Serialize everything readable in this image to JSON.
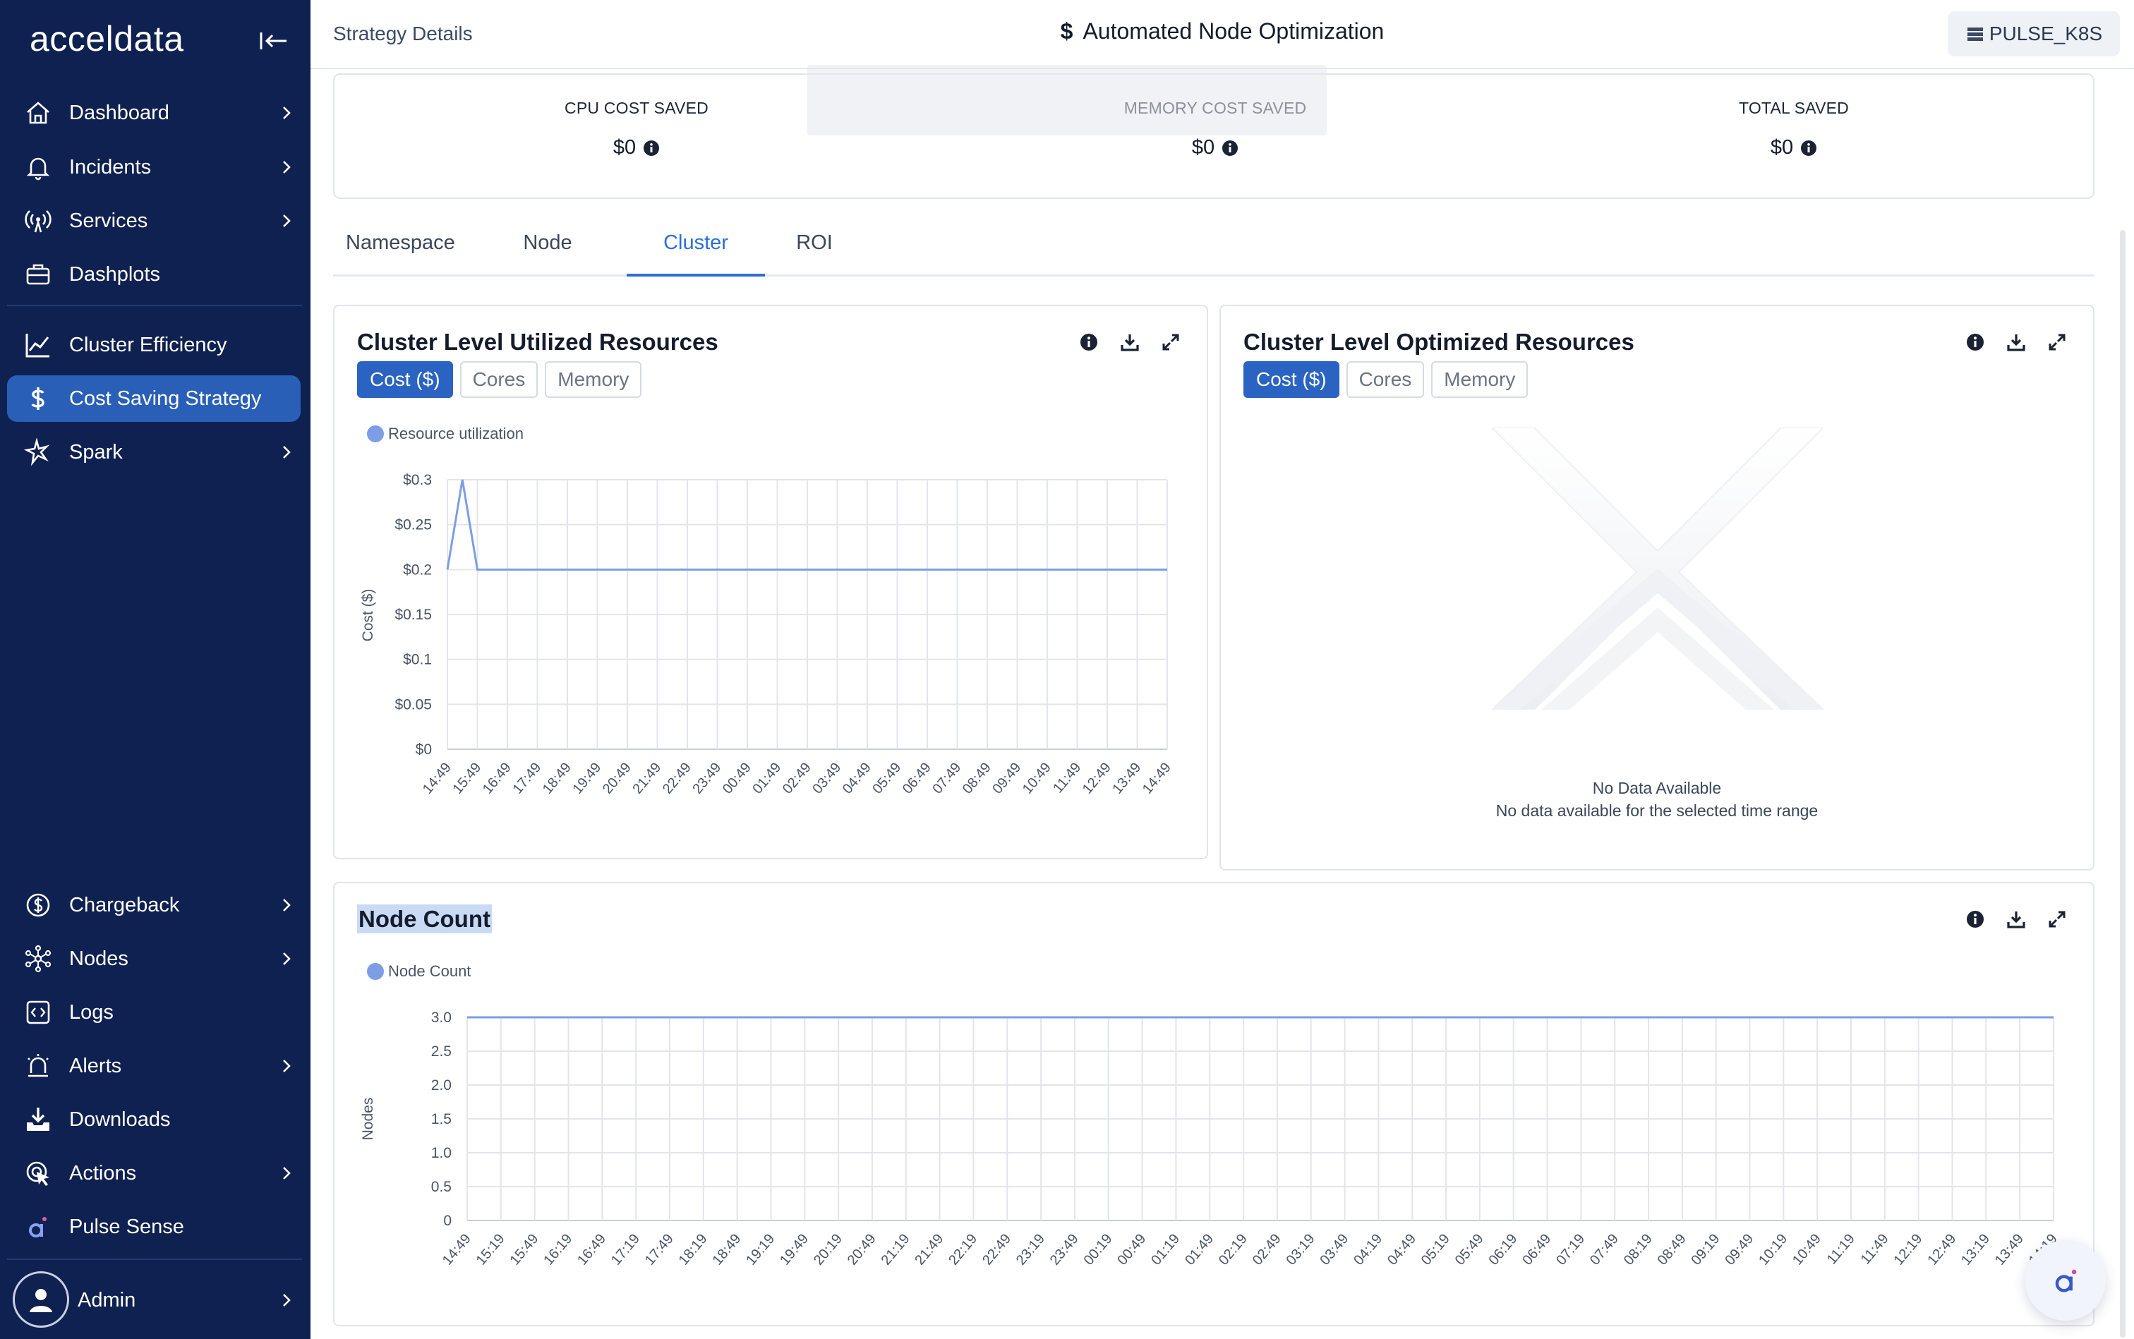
{
  "app": {
    "logo_text": "acceldata"
  },
  "sidebar": {
    "top_items": [
      {
        "label": "Dashboard",
        "icon": "home-icon",
        "chevron": true
      },
      {
        "label": "Incidents",
        "icon": "bell-icon",
        "chevron": true
      },
      {
        "label": "Services",
        "icon": "broadcast-icon",
        "chevron": true
      },
      {
        "label": "Dashplots",
        "icon": "briefcase-icon",
        "chevron": false
      }
    ],
    "mid_items": [
      {
        "label": "Cluster Efficiency",
        "icon": "trend-chart-icon",
        "chevron": false
      },
      {
        "label": "Cost Saving Strategy",
        "icon": "dollar-icon",
        "chevron": false,
        "active": true
      },
      {
        "label": "Spark",
        "icon": "spark-icon",
        "chevron": true
      }
    ],
    "bottom_items": [
      {
        "label": "Chargeback",
        "icon": "dollar-circle-icon",
        "chevron": true
      },
      {
        "label": "Nodes",
        "icon": "nodes-icon",
        "chevron": true
      },
      {
        "label": "Logs",
        "icon": "code-icon",
        "chevron": false
      },
      {
        "label": "Alerts",
        "icon": "alert-icon",
        "chevron": true
      },
      {
        "label": "Downloads",
        "icon": "download-icon",
        "chevron": false
      },
      {
        "label": "Actions",
        "icon": "cursor-click-icon",
        "chevron": true
      },
      {
        "label": "Pulse Sense",
        "icon": "pulse-sense-icon",
        "chevron": false
      }
    ],
    "admin_label": "Admin"
  },
  "header": {
    "breadcrumb": "Strategy Details",
    "title_symbol": "$",
    "title": "Automated Node Optimization",
    "cluster_chip": "PULSE_K8S"
  },
  "savings": [
    {
      "label": "CPU COST SAVED",
      "value": "$0"
    },
    {
      "label": "MEMORY COST SAVED",
      "value": "$0"
    },
    {
      "label": "TOTAL SAVED",
      "value": "$0"
    }
  ],
  "tabs": [
    "Namespace",
    "Node",
    "Cluster",
    "ROI"
  ],
  "active_tab": "Cluster",
  "cards": {
    "utilized": {
      "title": "Cluster Level Utilized Resources",
      "toggles": [
        "Cost ($)",
        "Cores",
        "Memory"
      ],
      "legend": "Resource utilization"
    },
    "optimized": {
      "title": "Cluster Level Optimized Resources",
      "toggles": [
        "Cost ($)",
        "Cores",
        "Memory"
      ],
      "no_data_title": "No Data Available",
      "no_data_subtitle": "No data available for the selected time range"
    },
    "node_count": {
      "title": "Node Count",
      "legend": "Node Count"
    }
  },
  "chart_data": [
    {
      "type": "line",
      "title": "Cluster Level Utilized Resources",
      "xlabel": "",
      "ylabel": "Cost ($)",
      "ylim": [
        0,
        0.3
      ],
      "yticks": [
        "$0",
        "$0.05",
        "$0.1",
        "$0.15",
        "$0.2",
        "$0.25",
        "$0.3"
      ],
      "x": [
        "14:49",
        "15:49",
        "16:49",
        "17:49",
        "18:49",
        "19:49",
        "20:49",
        "21:49",
        "22:49",
        "23:49",
        "00:49",
        "01:49",
        "02:49",
        "03:49",
        "04:49",
        "05:49",
        "06:49",
        "07:49",
        "08:49",
        "09:49",
        "10:49",
        "11:49",
        "12:49",
        "13:49",
        "14:49"
      ],
      "series": [
        {
          "name": "Resource utilization",
          "color": "#7d9ee6",
          "points": [
            [
              0,
              0.2
            ],
            [
              0.5,
              0.3
            ],
            [
              1,
              0.2
            ],
            [
              2,
              0.2
            ],
            [
              3,
              0.2
            ],
            [
              4,
              0.2
            ],
            [
              5,
              0.2
            ],
            [
              6,
              0.2
            ],
            [
              7,
              0.2
            ],
            [
              8,
              0.2
            ],
            [
              9,
              0.2
            ],
            [
              10,
              0.2
            ],
            [
              11,
              0.2
            ],
            [
              12,
              0.2
            ],
            [
              13,
              0.2
            ],
            [
              14,
              0.2
            ],
            [
              15,
              0.2
            ],
            [
              16,
              0.2
            ],
            [
              17,
              0.2
            ],
            [
              18,
              0.2
            ],
            [
              19,
              0.2
            ],
            [
              20,
              0.2
            ],
            [
              21,
              0.2
            ],
            [
              22,
              0.2
            ],
            [
              23,
              0.2
            ],
            [
              24,
              0.2
            ]
          ]
        }
      ],
      "grid": true,
      "legend_position": "top-left"
    },
    {
      "type": "line",
      "title": "Node Count",
      "xlabel": "",
      "ylabel": "Nodes",
      "ylim": [
        0,
        3
      ],
      "yticks": [
        "0",
        "0.5",
        "1.0",
        "1.5",
        "2.0",
        "2.5",
        "3.0"
      ],
      "x": [
        "14:49",
        "15:19",
        "15:49",
        "16:19",
        "16:49",
        "17:19",
        "17:49",
        "18:19",
        "18:49",
        "19:19",
        "19:49",
        "20:19",
        "20:49",
        "21:19",
        "21:49",
        "22:19",
        "22:49",
        "23:19",
        "23:49",
        "00:19",
        "00:49",
        "01:19",
        "01:49",
        "02:19",
        "02:49",
        "03:19",
        "03:49",
        "04:19",
        "04:49",
        "05:19",
        "05:49",
        "06:19",
        "06:49",
        "07:19",
        "07:49",
        "08:19",
        "08:49",
        "09:19",
        "09:49",
        "10:19",
        "10:49",
        "11:19",
        "11:49",
        "12:19",
        "12:49",
        "13:19",
        "13:49",
        "14:19"
      ],
      "series": [
        {
          "name": "Node Count",
          "color": "#7d9ee6",
          "value_constant": 3
        }
      ],
      "grid": true,
      "legend_position": "top-left"
    }
  ]
}
